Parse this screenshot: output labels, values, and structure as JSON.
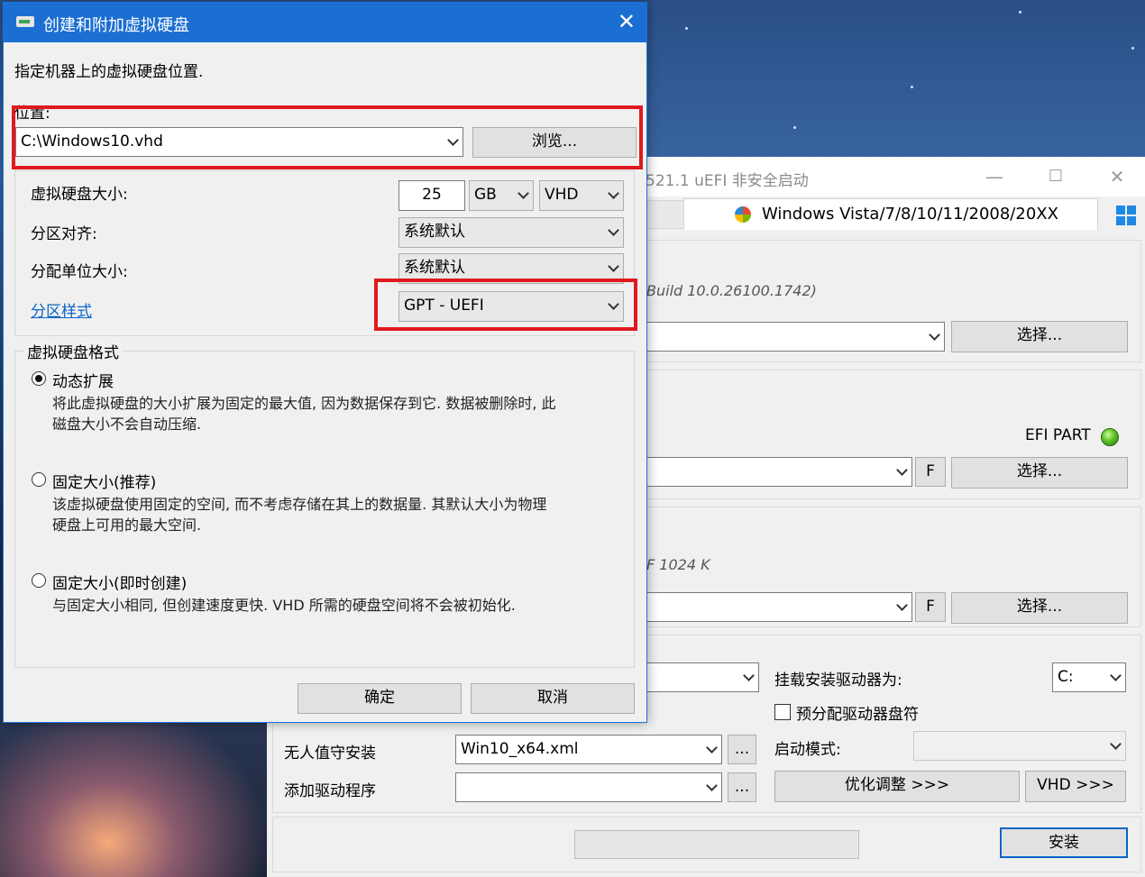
{
  "background_window": {
    "title_fragment": "521.1   uEFI 非安全启动",
    "min_glyph": "—",
    "max_glyph": "☐",
    "close_glyph": "✕",
    "active_tab": "Windows Vista/7/8/10/11/2008/20XX",
    "build_text": "Build 10.0.26100.1742)",
    "select_label": "选择...",
    "efi_part_label": "EFI PART",
    "size_text": "F 1024 K",
    "f_button": "F",
    "mount_label": "挂载安装驱动器为:",
    "mount_value": "C:",
    "prealloc_label": "预分配驱动器盘符",
    "unattended_label": "无人值守安装",
    "unattended_value": "Win10_x64.xml",
    "add_driver_label": "添加驱动程序",
    "ellipsis_button": "...",
    "boot_mode_label": "启动模式:",
    "optimize_button": "优化调整 >>>",
    "vhd_button": "VHD >>>",
    "install_button": "安装"
  },
  "dialog": {
    "title": "创建和附加虚拟硬盘",
    "close_glyph": "✕",
    "intro": "指定机器上的虚拟硬盘位置.",
    "location_label": "位置:",
    "location_value": "C:\\Windows10.vhd",
    "browse_button": "浏览...",
    "size_label": "虚拟硬盘大小:",
    "size_value": "25",
    "size_unit": "GB",
    "disk_type": "VHD",
    "alignment_label": "分区对齐:",
    "alignment_value": "系统默认",
    "cluster_label": "分配单位大小:",
    "cluster_value": "系统默认",
    "partition_style_link": "分区样式",
    "partition_style_value": "GPT - UEFI",
    "format_group_title": "虚拟硬盘格式",
    "options": [
      {
        "label": "动态扩展",
        "desc1": "将此虚拟硬盘的大小扩展为固定的最大值, 因为数据保存到它. 数据被删除时, 此",
        "desc2": "磁盘大小不会自动压缩.",
        "selected": true
      },
      {
        "label": "固定大小(推荐)",
        "desc1": "该虚拟硬盘使用固定的空间, 而不考虑存储在其上的数据量. 其默认大小为物理",
        "desc2": "硬盘上可用的最大空间.",
        "selected": false
      },
      {
        "label": "固定大小(即时创建)",
        "desc1": "与固定大小相同, 但创建速度更快. VHD 所需的硬盘空间将不会被初始化.",
        "desc2": "",
        "selected": false
      }
    ],
    "ok_button": "确定",
    "cancel_button": "取消"
  },
  "colors": {
    "dialog_title_bar": "#1c6fd2",
    "highlight_box": "#e0191f",
    "efi_led": "#5cbf26"
  }
}
